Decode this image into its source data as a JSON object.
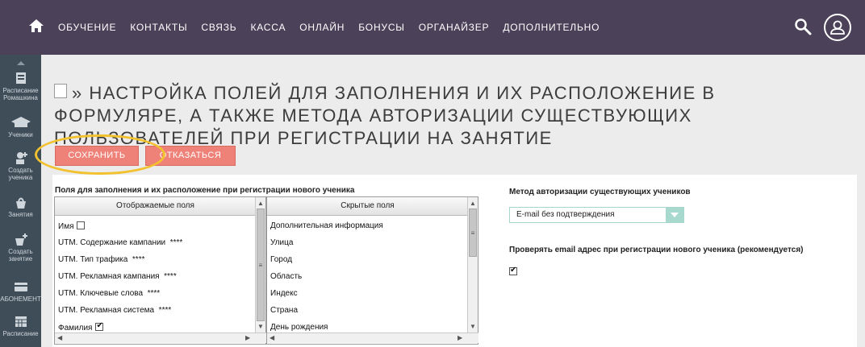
{
  "nav": {
    "items": [
      "ОБУЧЕНИЕ",
      "КОНТАКТЫ",
      "СВЯЗЬ",
      "КАССА",
      "ОНЛАЙН",
      "БОНУСЫ",
      "ОРГАНАЙЗЕР",
      "ДОПОЛНИТЕЛЬНО"
    ]
  },
  "sidebar": {
    "items": [
      {
        "label1": "Расписание",
        "label2": "Ромашкина",
        "icon": "calendar-icon"
      },
      {
        "label1": "Ученики",
        "label2": "",
        "icon": "students-icon"
      },
      {
        "label1": "Создать",
        "label2": "ученика",
        "icon": "add-student-icon"
      },
      {
        "label1": "Занятия",
        "label2": "",
        "icon": "lesson-icon"
      },
      {
        "label1": "Создать",
        "label2": "занятие",
        "icon": "add-lesson-icon"
      },
      {
        "label1": "АБОНЕМЕНТ",
        "label2": "",
        "icon": "card-icon"
      },
      {
        "label1": "Расписание",
        "label2": "",
        "icon": "schedule-icon"
      }
    ]
  },
  "page": {
    "title": "» НАСТРОЙКА ПОЛЕЙ ДЛЯ ЗАПОЛНЕНИЯ И ИХ РАСПОЛОЖЕНИЕ В ФОРМУЛЯРЕ, А ТАКЖЕ МЕТОДА АВТОРИЗАЦИИ СУЩЕСТВУЮЩИХ ПОЛЬЗОВАТЕЛЕЙ ПРИ РЕГИСТРАЦИИ НА ЗАНЯТИЕ",
    "save_label": "СОХРАНИТЬ",
    "cancel_label": "ОТКАЗАТЬСЯ"
  },
  "fields": {
    "section_label": "Поля для заполнения и их расположение при регистрации нового ученика",
    "displayed_header": "Отображаемые поля",
    "hidden_header": "Скрытые поля",
    "displayed": [
      {
        "label": "Имя",
        "suffix": "",
        "checkbox": "off"
      },
      {
        "label": "UTM. Содержание кампании",
        "suffix": "****",
        "checkbox": "none"
      },
      {
        "label": "UTM. Тип трафика",
        "suffix": "****",
        "checkbox": "none"
      },
      {
        "label": "UTM. Рекламная кампания",
        "suffix": "****",
        "checkbox": "none"
      },
      {
        "label": "UTM. Ключевые слова",
        "suffix": "****",
        "checkbox": "none"
      },
      {
        "label": "UTM. Рекламная система",
        "suffix": "****",
        "checkbox": "none"
      },
      {
        "label": "Фамилия",
        "suffix": "",
        "checkbox": "on"
      }
    ],
    "hidden": [
      "Дополнительная информация",
      "Улица",
      "Город",
      "Область",
      "Индекс",
      "Страна",
      "День рождения"
    ]
  },
  "auth": {
    "method_label": "Метод авторизации существующих учеников",
    "method_value": "E-mail без подтверждения",
    "verify_label": "Проверять email адрес при регистрации нового ученика (рекомендуется)",
    "verify_checked": true
  },
  "colors": {
    "topbar": "#4b4159",
    "sidebar": "#3f4d59",
    "button": "#ef8278",
    "highlight": "#f2c12e",
    "select_accent": "#a8d9ce"
  }
}
